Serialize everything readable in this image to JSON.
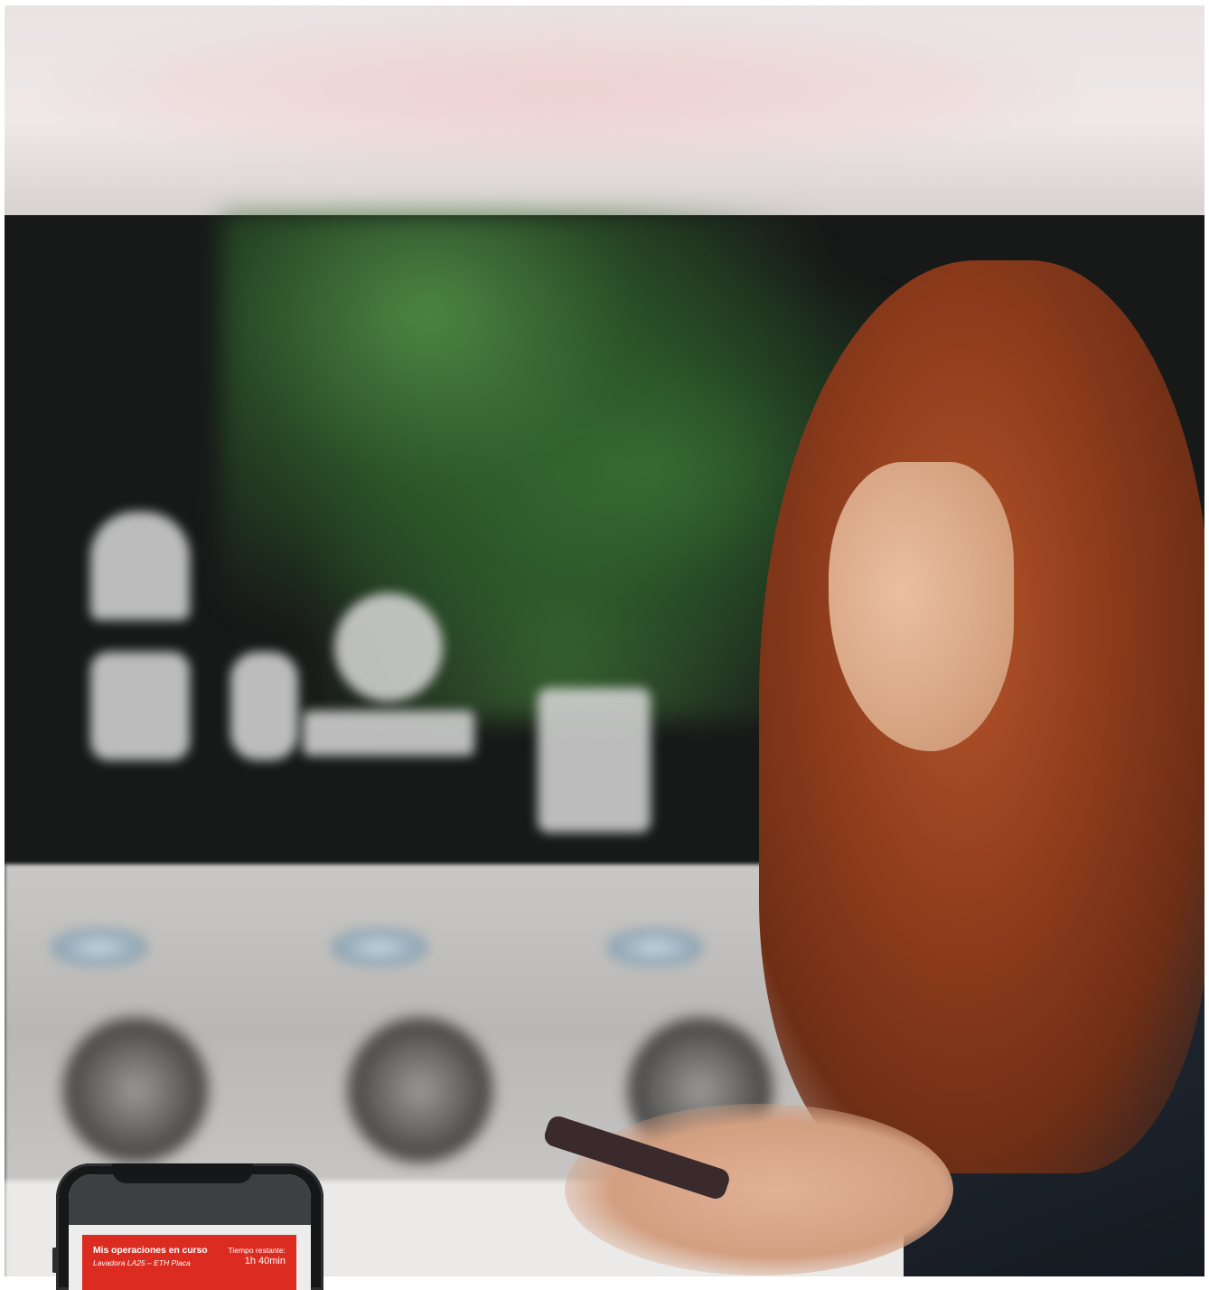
{
  "photo": {
    "subject": "woman-with-smartphone",
    "setting": "laundromat"
  },
  "app_card": {
    "title": "Mis operaciones en curso",
    "machine": "Lavadora LA25 – ETH Placa",
    "remaining_label": "Tiempo restante:",
    "remaining_value": "1h 40min",
    "accent_color": "#dc2b20"
  }
}
